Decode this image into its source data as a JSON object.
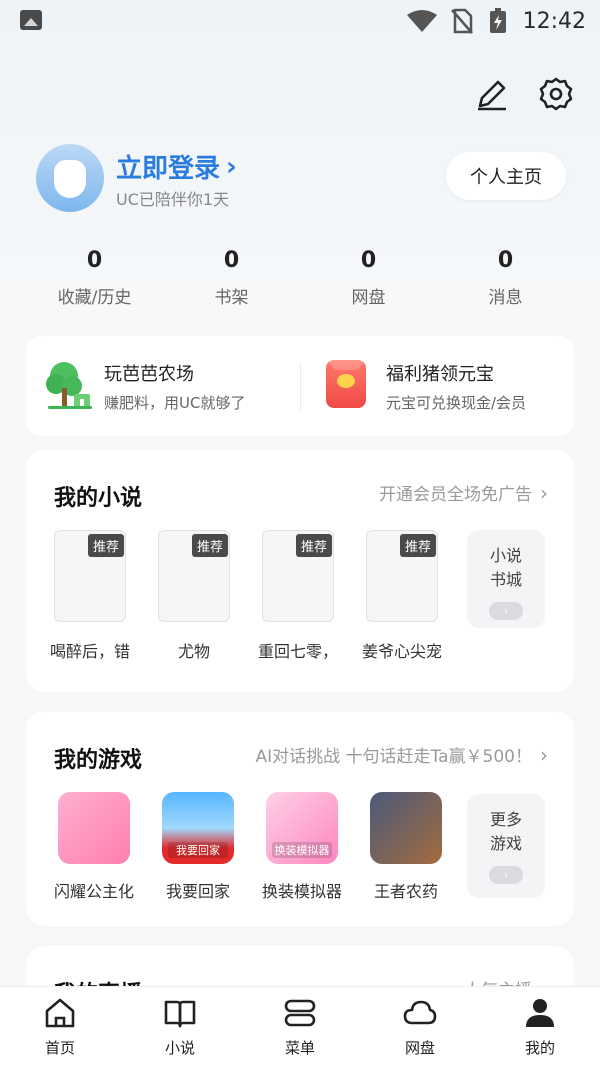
{
  "status_bar": {
    "time": "12:42"
  },
  "profile": {
    "login_label": "立即登录",
    "subtitle": "UC已陪伴你1天",
    "homepage_button": "个人主页"
  },
  "stats": [
    {
      "value": "0",
      "label": "收藏/历史"
    },
    {
      "value": "0",
      "label": "书架"
    },
    {
      "value": "0",
      "label": "网盘"
    },
    {
      "value": "0",
      "label": "消息"
    }
  ],
  "promos": [
    {
      "title": "玩芭芭农场",
      "desc": "赚肥料，用UC就够了"
    },
    {
      "title": "福利猪领元宝",
      "desc": "元宝可兑换现金/会员"
    }
  ],
  "novels": {
    "title": "我的小说",
    "link": "开通会员全场免广告",
    "badge": "推荐",
    "books": [
      "喝醉后，错",
      "尤物",
      "重回七零，",
      "姜爷心尖宠"
    ],
    "more_line1": "小说",
    "more_line2": "书城"
  },
  "games": {
    "title": "我的游戏",
    "link": "AI对话挑战 十句话赶走Ta赢￥500！",
    "items": [
      {
        "name": "闪耀公主化",
        "icon_text": ""
      },
      {
        "name": "我要回家",
        "icon_text": "我要回家"
      },
      {
        "name": "换装模拟器",
        "icon_text": "换装模拟器"
      },
      {
        "name": "王者农药",
        "icon_text": ""
      }
    ],
    "more_line1": "更多",
    "more_line2": "游戏"
  },
  "live": {
    "title": "我的直播",
    "link": "人气主播"
  },
  "nav": [
    {
      "label": "首页",
      "icon": "home-icon"
    },
    {
      "label": "小说",
      "icon": "book-icon"
    },
    {
      "label": "菜单",
      "icon": "menu-icon"
    },
    {
      "label": "网盘",
      "icon": "cloud-icon"
    },
    {
      "label": "我的",
      "icon": "user-icon"
    }
  ]
}
